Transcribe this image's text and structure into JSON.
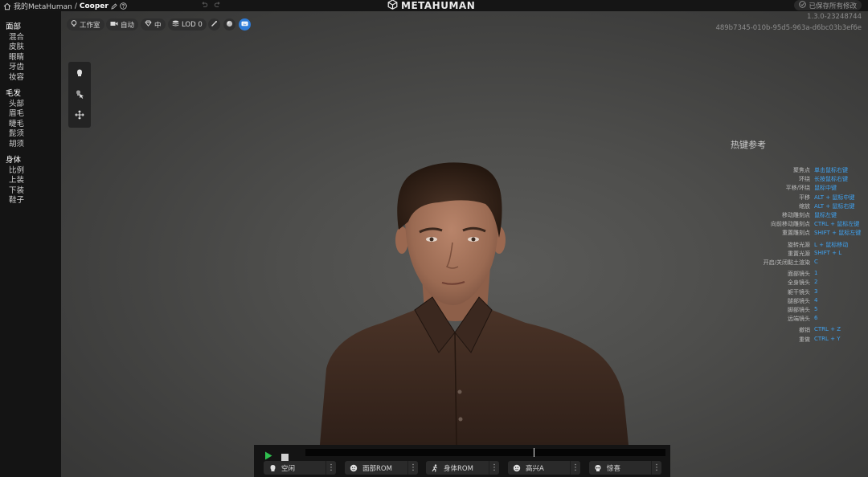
{
  "breadcrumb": {
    "root": "我的MetaHuman",
    "separator": "/",
    "current": "Cooper"
  },
  "logo_text": "METAHUMAN",
  "save_status": "已保存所有修改",
  "sidebar": [
    {
      "group": "面部",
      "items": [
        "混合",
        "皮肤",
        "眼睛",
        "牙齿",
        "妆容"
      ]
    },
    {
      "group": "毛发",
      "items": [
        "头部",
        "眉毛",
        "睫毛",
        "髭须",
        "胡须"
      ]
    },
    {
      "group": "身体",
      "items": [
        "比例",
        "上装",
        "下装",
        "鞋子"
      ]
    }
  ],
  "toolbar": {
    "studio": "工作室",
    "auto": "自动",
    "quality": "中",
    "lod": "LOD 0"
  },
  "version": "1.3.0-23248744",
  "build_id": "489b7345-010b-95d5-963a-d6bc03b3ef6e",
  "hotkeys": {
    "title": "热键参考",
    "rows": [
      {
        "label": "聚焦点",
        "value": "单击鼠标右键"
      },
      {
        "label": "环绕",
        "value": "长按鼠标右键"
      },
      {
        "label": "平移/环绕",
        "value": "鼠标中键"
      },
      {
        "label": "平移",
        "value": "ALT + 鼠标中键"
      },
      {
        "label": "缩放",
        "value": "ALT + 鼠标右键"
      },
      {
        "label": "移动雕刻点",
        "value": "鼠标左键"
      },
      {
        "label": "向前移动雕刻点",
        "value": "CTRL + 鼠标左键"
      },
      {
        "label": "重置雕刻点",
        "value": "SHIFT + 鼠标左键"
      },
      {
        "label": "旋转光源",
        "value": "L + 鼠标移动"
      },
      {
        "label": "重置光源",
        "value": "SHIFT + L"
      },
      {
        "label": "开启/关闭黏土渲染",
        "value": "C"
      },
      {
        "label": "面部镜头",
        "value": "1"
      },
      {
        "label": "全身镜头",
        "value": "2"
      },
      {
        "label": "躯干镜头",
        "value": "3"
      },
      {
        "label": "腿部镜头",
        "value": "4"
      },
      {
        "label": "脚部镜头",
        "value": "5"
      },
      {
        "label": "远端镜头",
        "value": "6"
      },
      {
        "label": "撤销",
        "value": "CTRL + Z"
      },
      {
        "label": "重做",
        "value": "CTRL + Y"
      }
    ]
  },
  "player": {
    "playhead_fraction": 0.635,
    "animations": [
      {
        "label": "空闲",
        "icon": "head-icon"
      },
      {
        "label": "面部ROM",
        "icon": "face-icon"
      },
      {
        "label": "身体ROM",
        "icon": "running-figure-icon"
      },
      {
        "label": "高兴A",
        "icon": "face-icon"
      },
      {
        "label": "惊喜",
        "icon": "skull-icon"
      }
    ],
    "more_glyph": "⋮"
  }
}
